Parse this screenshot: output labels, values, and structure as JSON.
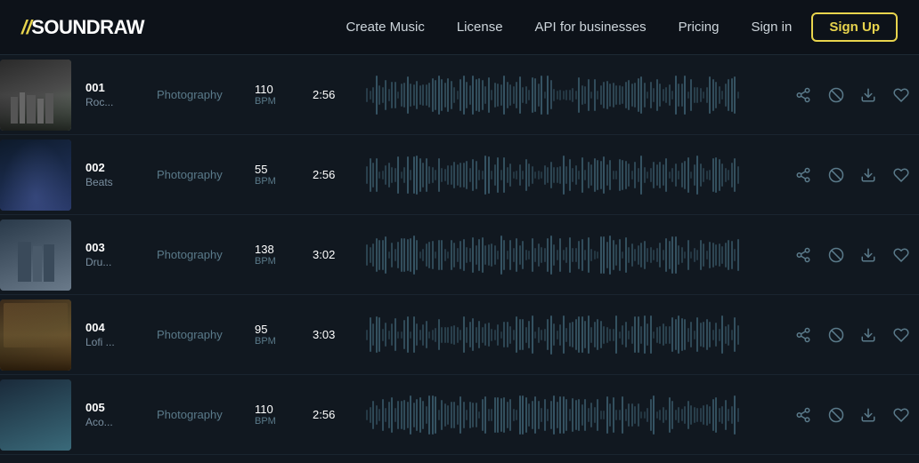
{
  "header": {
    "logo": "SOUNDRAW",
    "logo_prefix": "//",
    "nav": {
      "create_music": "Create Music",
      "license": "License",
      "api": "API for businesses",
      "pricing": "Pricing",
      "signin": "Sign in",
      "signup": "Sign Up"
    }
  },
  "tracks": [
    {
      "num": "001",
      "name": "Roc...",
      "genre": "Photography",
      "bpm": "110",
      "duration": "2:56",
      "thumb_class": "thumb-1",
      "waveform_seed": 1
    },
    {
      "num": "002",
      "name": "Beats",
      "genre": "Photography",
      "bpm": "55",
      "duration": "2:56",
      "thumb_class": "thumb-2",
      "waveform_seed": 2
    },
    {
      "num": "003",
      "name": "Dru...",
      "genre": "Photography",
      "bpm": "138",
      "duration": "3:02",
      "thumb_class": "thumb-3",
      "waveform_seed": 3
    },
    {
      "num": "004",
      "name": "Lofi ...",
      "genre": "Photography",
      "bpm": "95",
      "duration": "3:03",
      "thumb_class": "thumb-4",
      "waveform_seed": 4
    },
    {
      "num": "005",
      "name": "Aco...",
      "genre": "Photography",
      "bpm": "110",
      "duration": "2:56",
      "thumb_class": "thumb-5",
      "waveform_seed": 5
    }
  ],
  "bpm_label": "BPM"
}
